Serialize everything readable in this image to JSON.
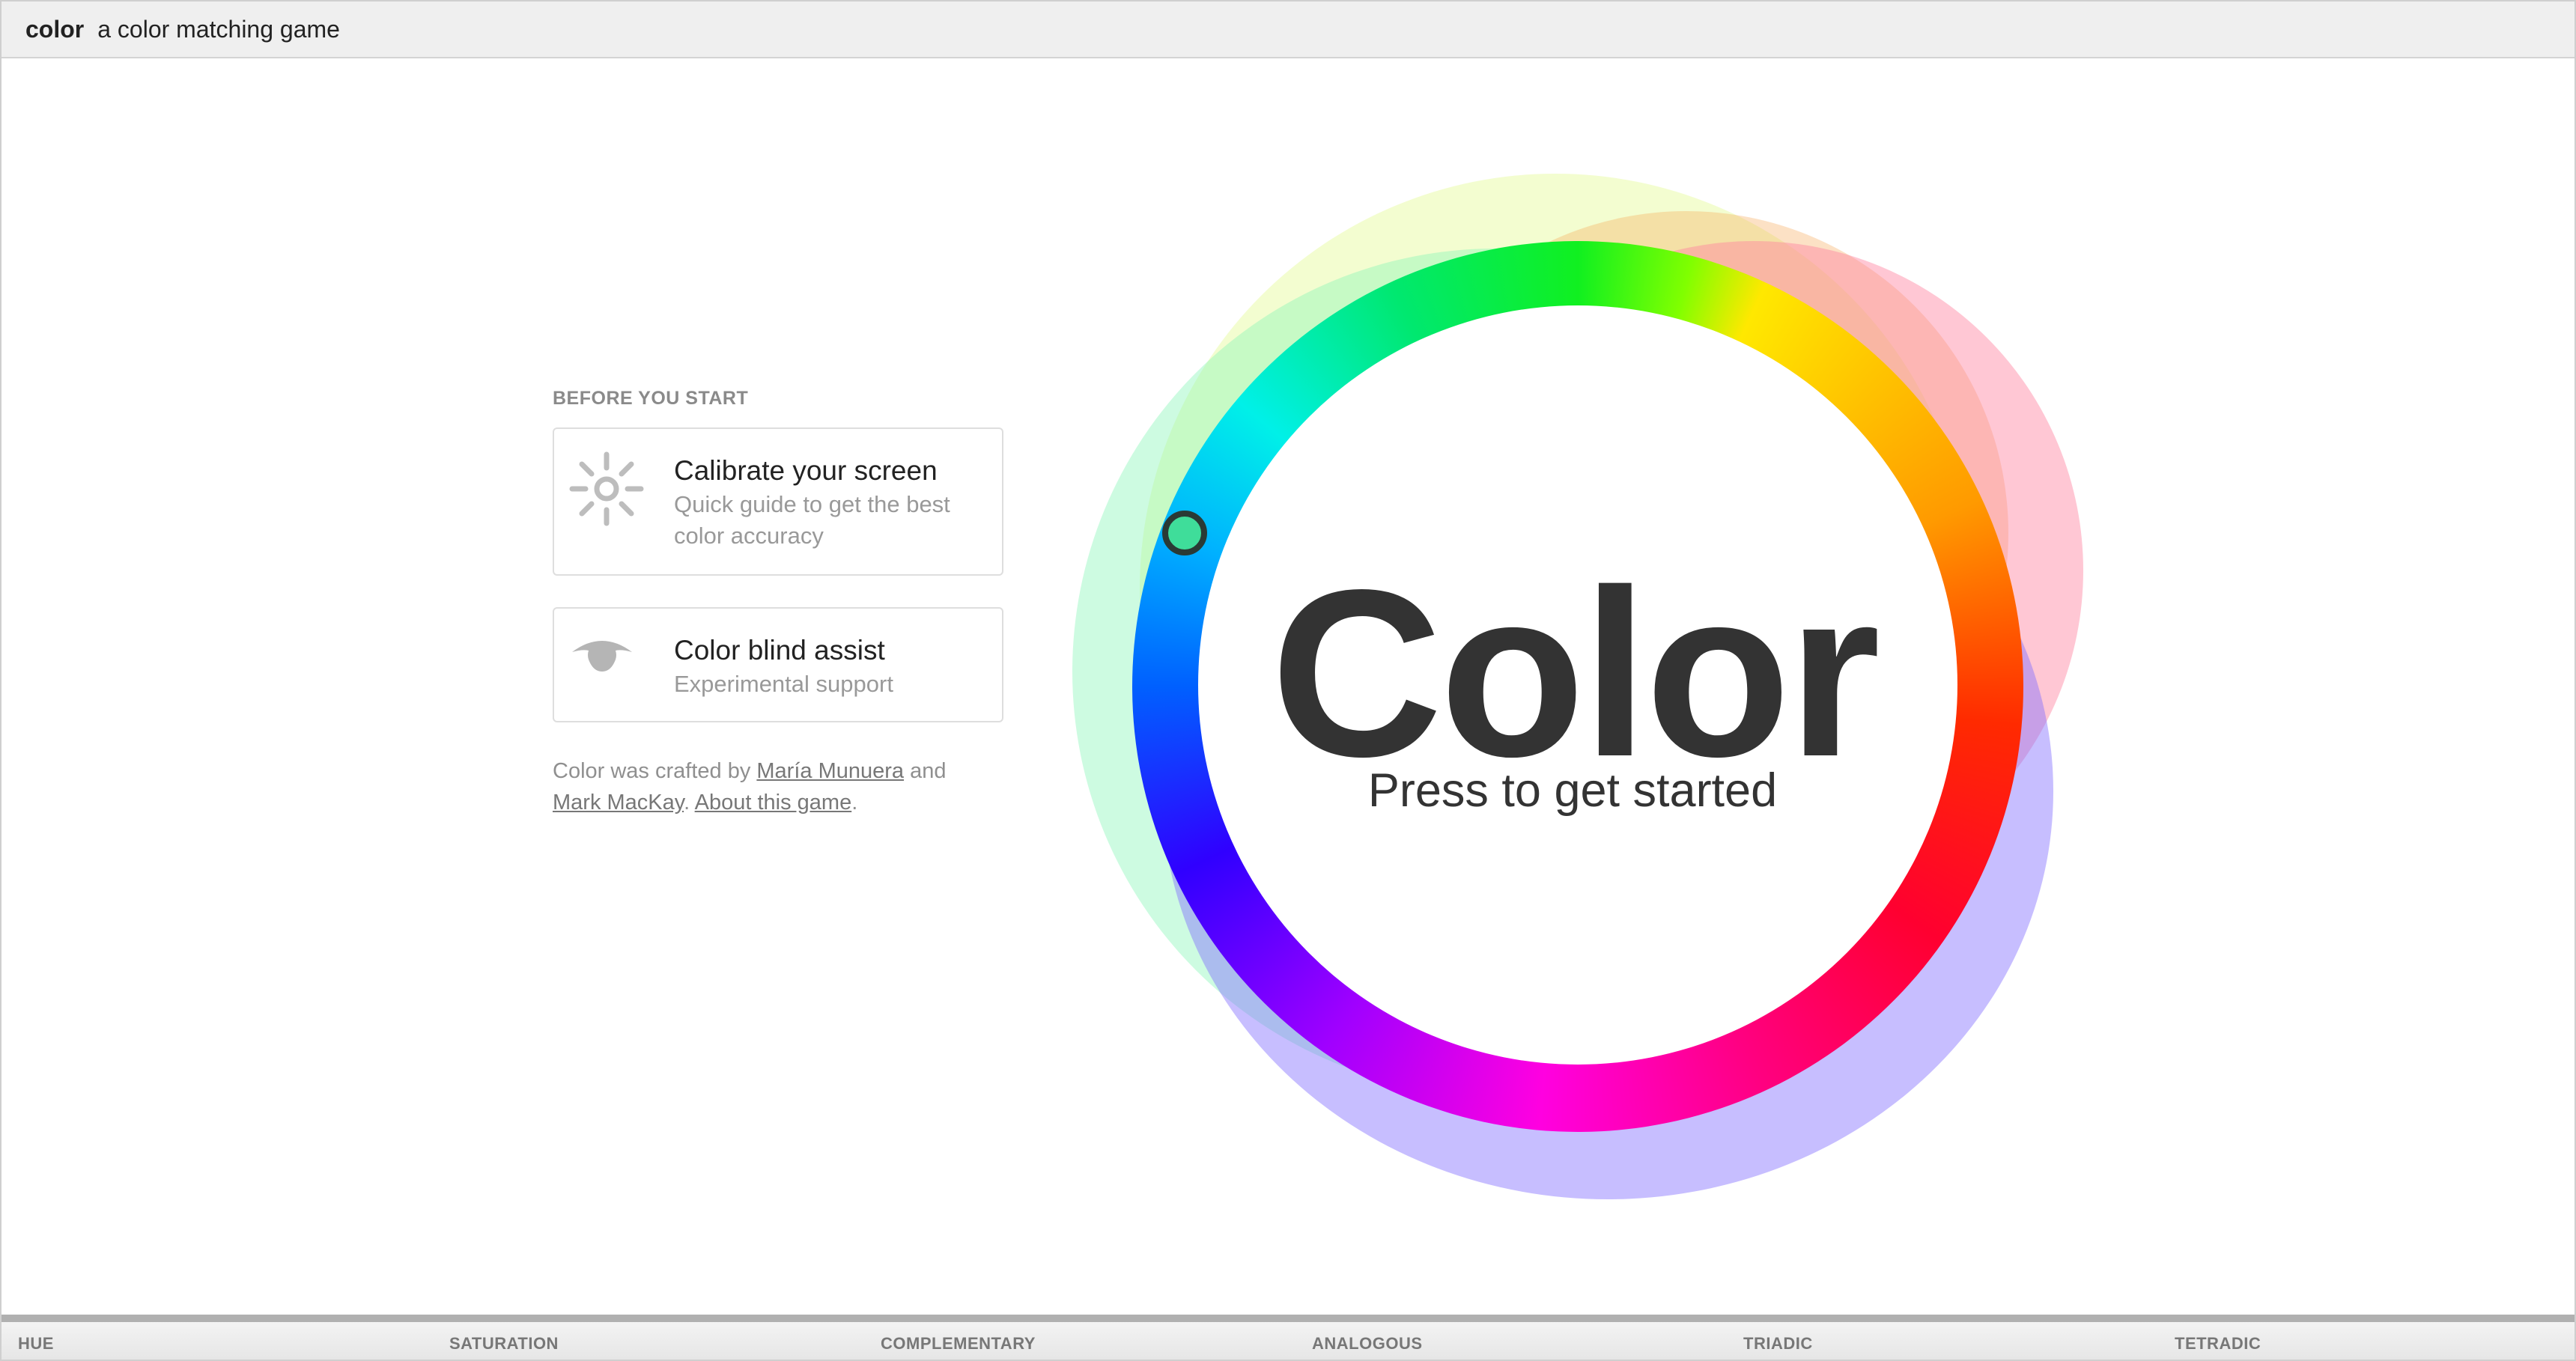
{
  "header": {
    "brand": "color",
    "tagline": "a color matching game"
  },
  "left_panel": {
    "section_title": "BEFORE YOU START",
    "cards": [
      {
        "title": "Calibrate your screen",
        "subtitle": "Quick guide to get the best color accuracy",
        "icon": "sun-icon"
      },
      {
        "title": "Color blind assist",
        "subtitle": "Experimental support",
        "icon": "eye-icon"
      }
    ],
    "credits": {
      "prefix": "Color was crafted by ",
      "author1": "María Munuera",
      "and": " and",
      "author2": "Mark MacKay",
      "sep": ". ",
      "about": "About this game",
      "suffix": "."
    }
  },
  "main": {
    "title": "Color",
    "subtitle": "Press to get started"
  },
  "modes": [
    "HUE",
    "SATURATION",
    "COMPLEMENTARY",
    "ANALOGOUS",
    "TRIADIC",
    "TETRADIC"
  ],
  "colors": {
    "header_bg": "#efefef",
    "text_dark": "#333333",
    "muted": "#999999",
    "handle_fill": "#3fdd9a"
  }
}
